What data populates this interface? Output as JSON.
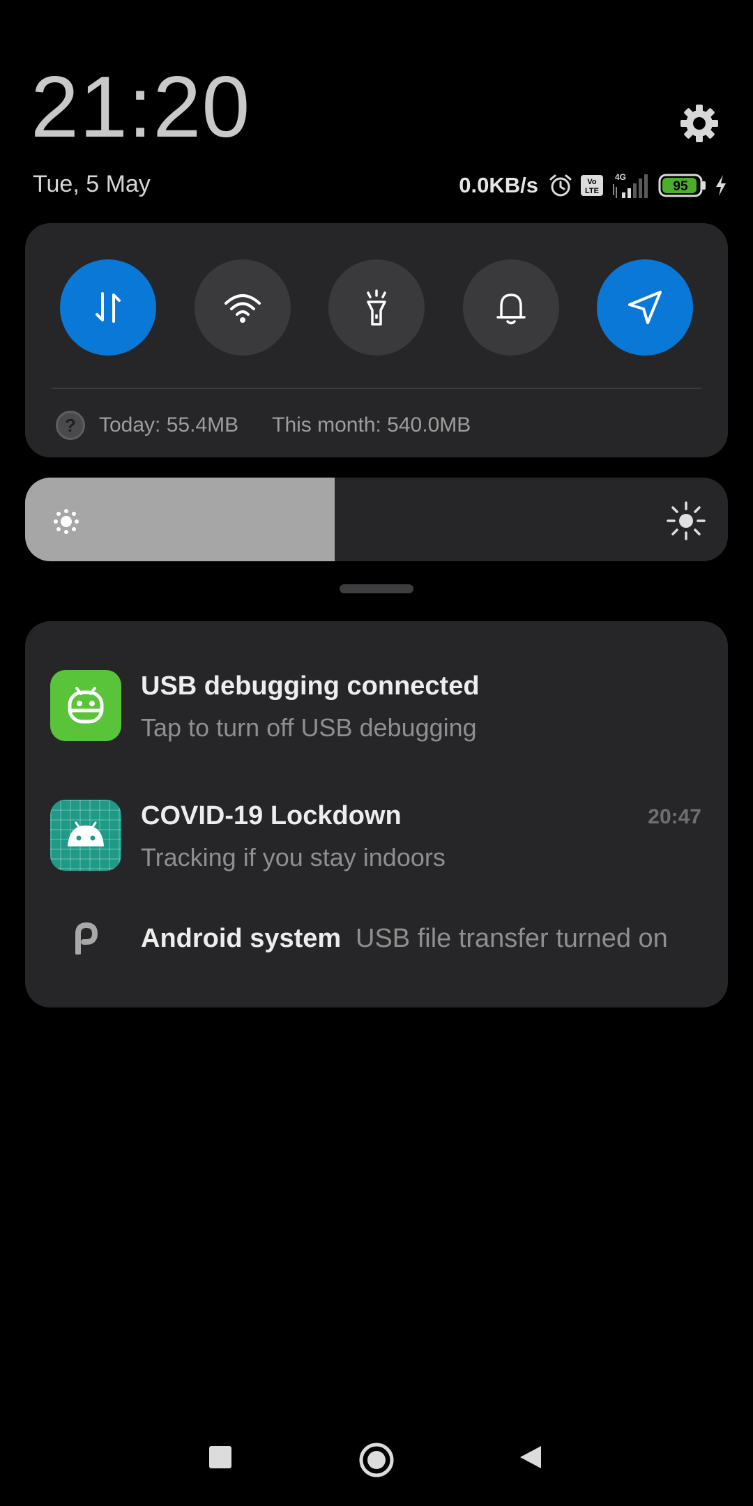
{
  "header": {
    "time": "21:20",
    "date": "Tue, 5 May",
    "settings_icon": "gear-icon"
  },
  "status_bar": {
    "net_speed": "0.0KB/s",
    "icons": [
      "alarm-icon",
      "volte-icon",
      "4g-signal-icon"
    ],
    "network_label": "4G",
    "volte_top": "Vo",
    "volte_bottom": "LTE",
    "battery_level": "95",
    "battery_fraction": 0.95,
    "charging": true,
    "battery_color": "#4caf2a"
  },
  "quick_settings": {
    "toggles": [
      {
        "name": "mobile-data",
        "icon": "data-arrows-icon",
        "active": true
      },
      {
        "name": "wifi",
        "icon": "wifi-icon",
        "active": false
      },
      {
        "name": "flashlight",
        "icon": "flashlight-icon",
        "active": false
      },
      {
        "name": "sound",
        "icon": "bell-icon",
        "active": false
      },
      {
        "name": "location",
        "icon": "location-arrow-icon",
        "active": true
      }
    ],
    "active_color": "#0a78d7",
    "usage_help_glyph": "?",
    "usage_today": "Today: 55.4MB",
    "usage_month": "This month: 540.0MB"
  },
  "brightness": {
    "level": 0.44
  },
  "notifications": [
    {
      "title": "USB debugging connected",
      "text": "Tap to turn off USB debugging",
      "icon": "android-debug-icon",
      "time": ""
    },
    {
      "title": "COVID-19 Lockdown",
      "text": "Tracking if you stay indoors",
      "icon": "android-app-icon",
      "time": "20:47"
    },
    {
      "title": "Android system",
      "text": "USB file transfer turned on",
      "icon": "p-icon",
      "time": ""
    }
  ],
  "navigation": {
    "buttons": [
      "recents-square-icon",
      "home-circle-icon",
      "back-triangle-icon"
    ]
  }
}
